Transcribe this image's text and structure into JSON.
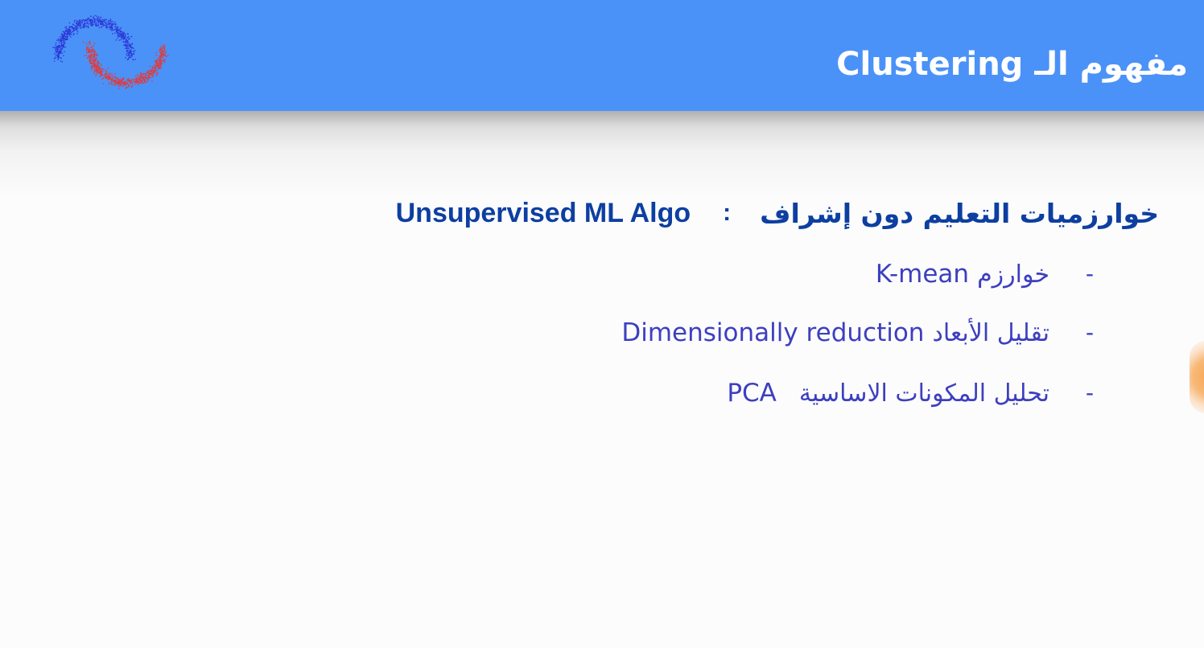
{
  "slide": {
    "title_ar": "مفهوم الـ",
    "title_en": "Clustering",
    "heading": {
      "ar": "خوارزميات التعليم دون إشراف",
      "colon": ":",
      "en": "Unsupervised ML Algo"
    },
    "bullets": [
      {
        "dash": "-",
        "ar": "خوارزم",
        "en": "K-mean"
      },
      {
        "dash": "-",
        "ar": "تقليل الأبعاد",
        "en": "Dimensionally reduction"
      },
      {
        "dash": "-",
        "ar": "تحليل المكونات الاساسية",
        "en": "PCA"
      }
    ]
  },
  "colors": {
    "header_bg": "#4a92f8",
    "heading_text": "#0d3fa1",
    "bullet_text": "#3d3fbf",
    "logo_blue": "#2d39d8",
    "logo_red": "#e23a3a"
  },
  "icons": {
    "logo": "two-moons-scatter-icon",
    "side_handle": "slide-edge-handle-icon"
  }
}
